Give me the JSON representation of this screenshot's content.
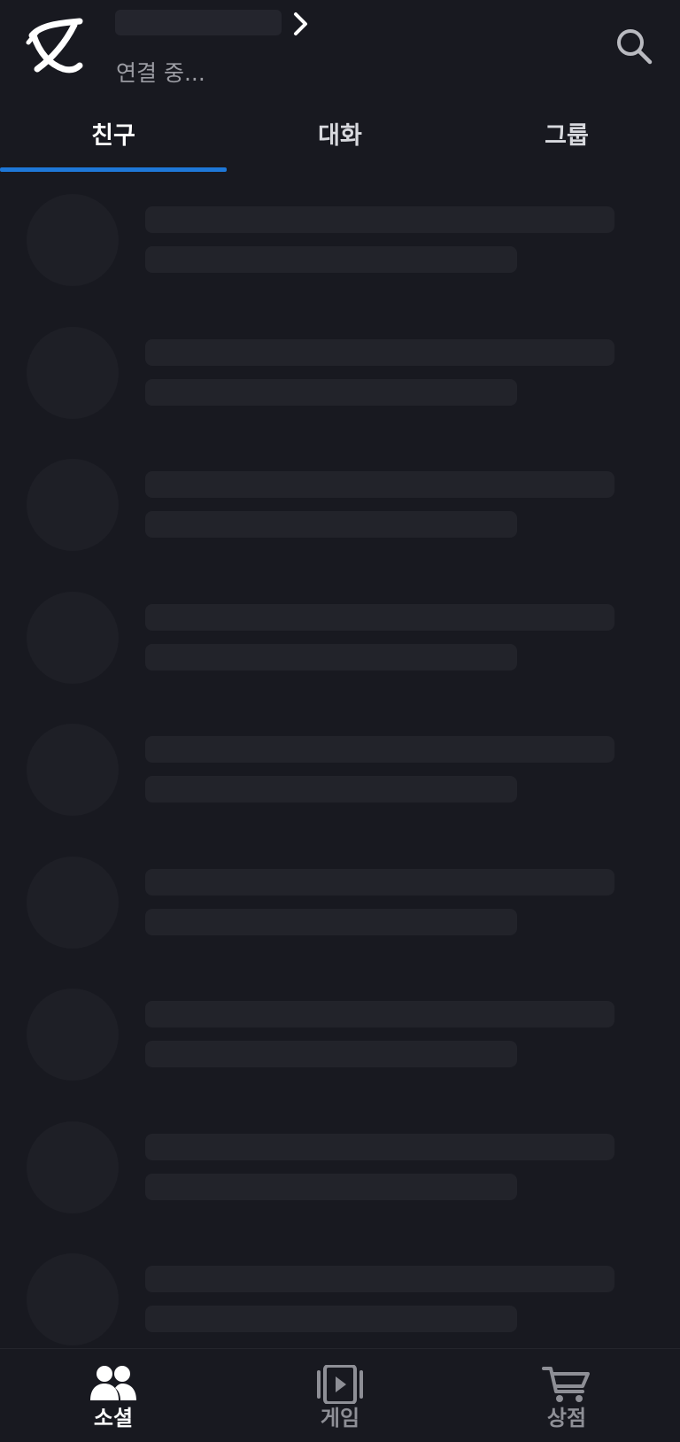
{
  "header": {
    "status_text": "연결 중...",
    "logo_icon": "app-logo",
    "chevron_icon": "chevron-right-icon",
    "search_icon": "search-icon"
  },
  "tabs": [
    {
      "label": "친구",
      "active": true
    },
    {
      "label": "대화",
      "active": false
    },
    {
      "label": "그룹",
      "active": false
    }
  ],
  "colors": {
    "background": "#181920",
    "accent": "#1e78d8",
    "skeleton": "#22232a",
    "muted_text": "#9b9ca3"
  },
  "list": {
    "state": "loading",
    "placeholder_rows": 9
  },
  "bottom_nav": [
    {
      "label": "소셜",
      "icon": "people-icon",
      "active": true
    },
    {
      "label": "게임",
      "icon": "game-play-icon",
      "active": false
    },
    {
      "label": "상점",
      "icon": "cart-icon",
      "active": false
    }
  ]
}
